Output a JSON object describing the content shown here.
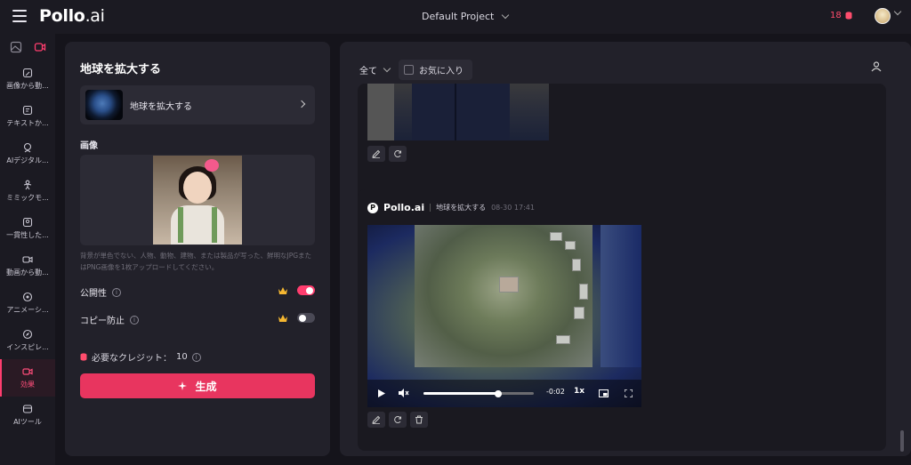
{
  "header": {
    "logo_main": "Pollo",
    "logo_suffix": ".ai",
    "project": "Default Project",
    "credits": "18",
    "credit_icon": "coin-stack-icon"
  },
  "sidebar": {
    "top_icons": [
      "image-icon",
      "video-icon"
    ],
    "items": [
      {
        "label": "画像から動...",
        "icon": "image-to-video-icon"
      },
      {
        "label": "テキストか...",
        "icon": "text-to-video-icon"
      },
      {
        "label": "AIデジタル...",
        "icon": "avatar-icon"
      },
      {
        "label": "ミミックモ...",
        "icon": "mimic-icon"
      },
      {
        "label": "一貫性した...",
        "icon": "consistent-icon"
      },
      {
        "label": "動画から動...",
        "icon": "video-to-video-icon"
      },
      {
        "label": "アニメーシ...",
        "icon": "animation-icon"
      },
      {
        "label": "インスピレ...",
        "icon": "compass-icon"
      },
      {
        "label": "効果",
        "icon": "effects-icon",
        "active": true
      },
      {
        "label": "AIツール",
        "icon": "tools-icon"
      }
    ]
  },
  "left_panel": {
    "title": "地球を拡大する",
    "effect_card_label": "地球を拡大する",
    "image_section": "画像",
    "hint": "背景が単色でない、人物、動物、建物、または製品が写った、鮮明なJPGまたはPNG画像を1枚アップロードしてください。",
    "public_label": "公開性",
    "public_on": true,
    "copy_protect_label": "コピー防止",
    "copy_protect_on": false,
    "credits_required_label": "必要なクレジット：",
    "credits_required_value": "10",
    "generate_label": "生成"
  },
  "right_panel": {
    "filter_all": "全て",
    "favorites": "お気に入り",
    "card2": {
      "brand": "Pollo.ai",
      "effect": "地球を拡大する",
      "timestamp": "08-30 17:41",
      "video_time": "-0:02",
      "speed": "1x",
      "progress": 0.68
    }
  },
  "colors": {
    "accent": "#e8355f",
    "background": "#15141b",
    "panel": "#22212a"
  }
}
